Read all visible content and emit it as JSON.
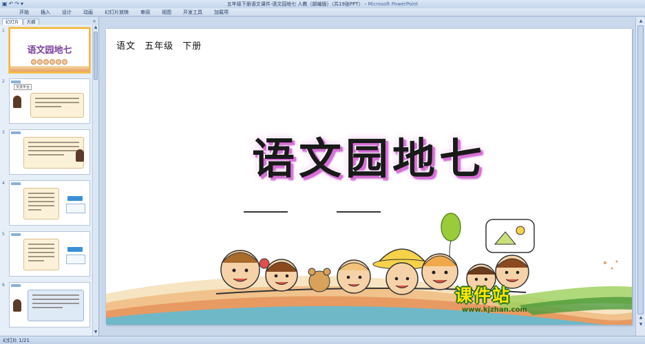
{
  "window": {
    "title": "五年级下册语文课件-语文园地七  人教（部编版）（共19张PPT）",
    "app_name": "Microsoft PowerPoint",
    "separator": " - "
  },
  "quick_access": [
    "save-icon",
    "undo-icon",
    "redo-icon",
    "customize-icon"
  ],
  "ribbon_tabs": [
    "开始",
    "插入",
    "设计",
    "动画",
    "幻灯片放映",
    "审阅",
    "视图",
    "开发工具",
    "加载项"
  ],
  "panel_tabs": {
    "slides": "幻灯片",
    "outline": "大纲",
    "close": "×"
  },
  "thumbnails": [
    {
      "num": "1",
      "title": "语文园地七"
    },
    {
      "num": "2",
      "chip": "交流平台"
    },
    {
      "num": "3"
    },
    {
      "num": "4"
    },
    {
      "num": "5"
    },
    {
      "num": "6"
    }
  ],
  "slide": {
    "subject_line": "语文  五年级  下册",
    "title": "语文园地七"
  },
  "watermark": {
    "brand": "课件站",
    "url": "www.kjzhan.com"
  },
  "status": {
    "slide_indicator": "幻灯片 1/21"
  }
}
